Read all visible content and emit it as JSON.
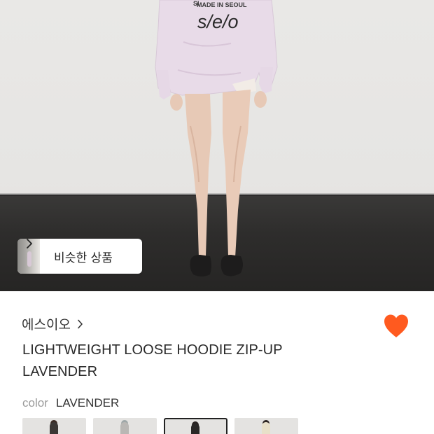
{
  "photo": {
    "shirt_print_lines": [
      "MADE IN SEOUL"
    ],
    "shirt_logo": "s/e/o"
  },
  "similar": {
    "label": "비슷한 상품",
    "chevron_icon": "chevron-right-icon"
  },
  "brand": {
    "name": "에스이오",
    "chevron_icon": "chevron-right-icon"
  },
  "wishlist": {
    "icon": "heart-icon",
    "active": true,
    "color": "#ff5a1f"
  },
  "product": {
    "title": "LIGHTWEIGHT LOOSE HOODIE ZIP-UP LAVENDER"
  },
  "color_option": {
    "key": "color",
    "value": "LAVENDER"
  },
  "swatches": [
    {
      "name": "black",
      "tone": "#3b3735",
      "selected": false
    },
    {
      "name": "gray",
      "tone": "#b9b7b4",
      "selected": false
    },
    {
      "name": "dark",
      "tone": "#2a2827",
      "selected": true
    },
    {
      "name": "cream",
      "tone": "#e8e0c9",
      "selected": false
    }
  ]
}
